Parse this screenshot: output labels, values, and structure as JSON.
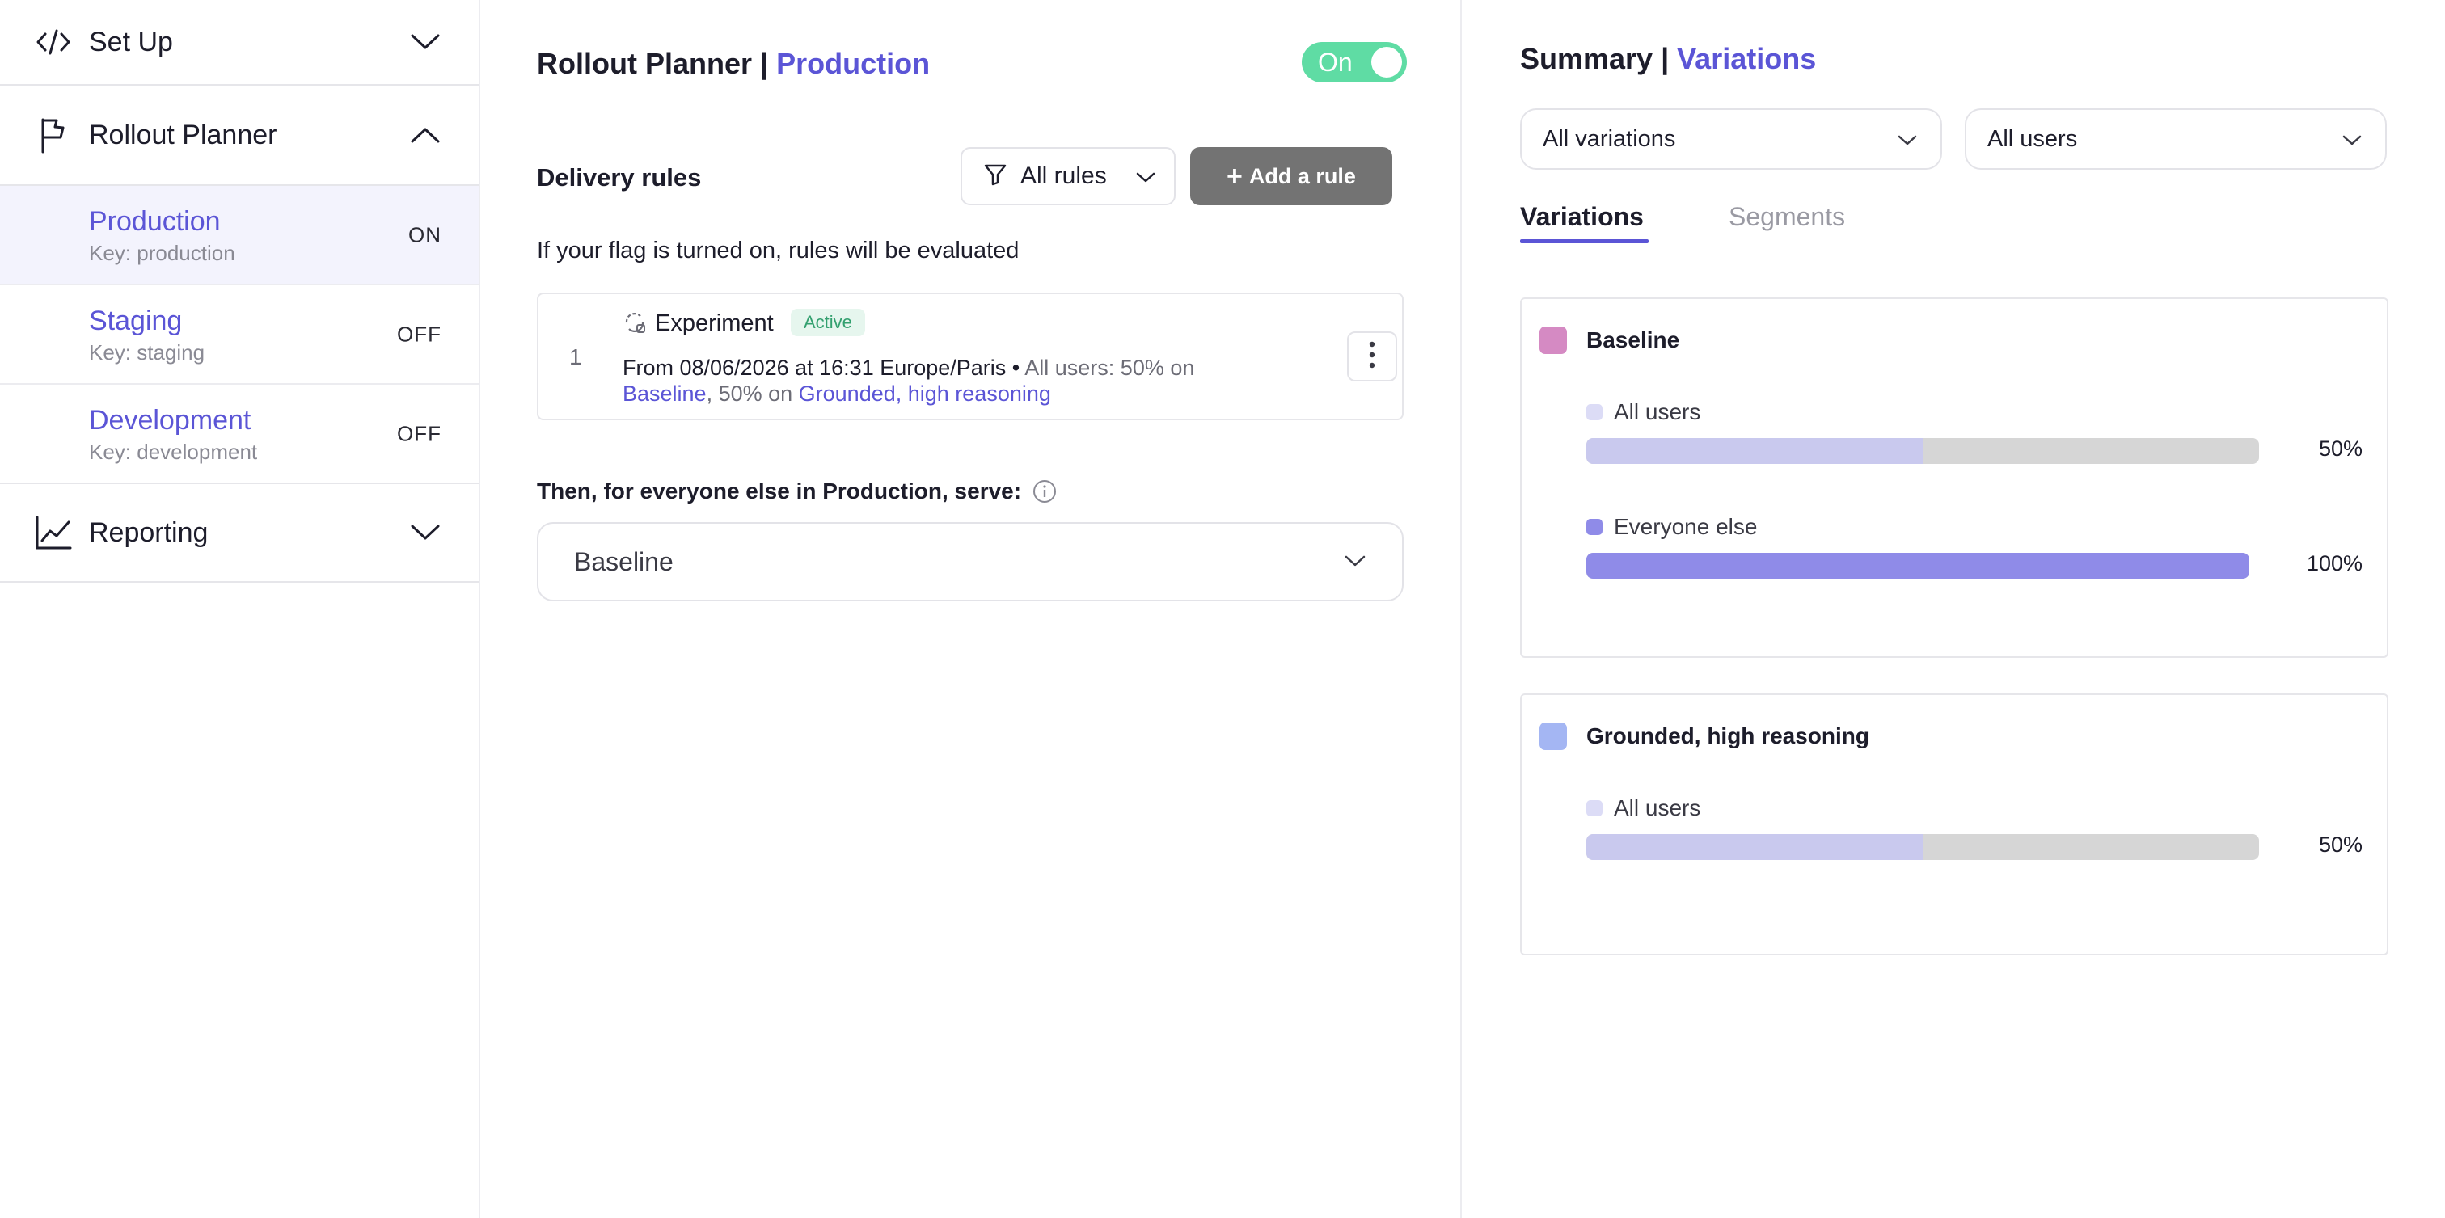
{
  "sidebar": {
    "setup": {
      "label": "Set Up"
    },
    "rollout": {
      "label": "Rollout Planner"
    },
    "environments": [
      {
        "name": "Production",
        "key": "Key: production",
        "state": "ON"
      },
      {
        "name": "Staging",
        "key": "Key: staging",
        "state": "OFF"
      },
      {
        "name": "Development",
        "key": "Key: development",
        "state": "OFF"
      }
    ],
    "reporting": {
      "label": "Reporting"
    }
  },
  "planner": {
    "title_prefix": "Rollout Planner | ",
    "title_env": "Production",
    "toggle_label": "On",
    "rules_title": "Delivery rules",
    "filter_label": "All rules",
    "add_rule_label": "Add a rule",
    "hint": "If your flag is turned on, rules will be evaluated",
    "rule": {
      "number": "1",
      "type": "Experiment",
      "status": "Active",
      "schedule": "From 08/06/2026 at 16:31 Europe/Paris • ",
      "audience": "All users: 50% on",
      "variation_a": "Baseline",
      "split_text": ", 50% on ",
      "variation_b": "Grounded, high reasoning"
    },
    "serve_label": "Then, for everyone else in Production, serve:",
    "serve_value": "Baseline"
  },
  "summary": {
    "title_prefix": "Summary | ",
    "title_accent": "Variations",
    "dropdown_variations": "All variations",
    "dropdown_users": "All users",
    "tabs": [
      "Variations",
      "Segments"
    ],
    "variations": [
      {
        "name": "Baseline",
        "color": "#d58ac3",
        "segments": [
          {
            "label": "All users",
            "percent": 50,
            "percent_label": "50%",
            "dot": "#dcdcf6",
            "fill": "#c9c9ee"
          },
          {
            "label": "Everyone else",
            "percent": 100,
            "percent_label": "100%",
            "dot": "#8f8be8",
            "fill": "#8f8be8"
          }
        ]
      },
      {
        "name": "Grounded, high reasoning",
        "color": "#a4b6f3",
        "segments": [
          {
            "label": "All users",
            "percent": 50,
            "percent_label": "50%",
            "dot": "#dcdcf6",
            "fill": "#c9c9ee"
          }
        ]
      }
    ]
  },
  "colors": {
    "accent": "#5b55d6",
    "toggle_on": "#5fdca4",
    "active_badge_bg": "#e6f6ee",
    "active_badge_text": "#33a06f"
  }
}
